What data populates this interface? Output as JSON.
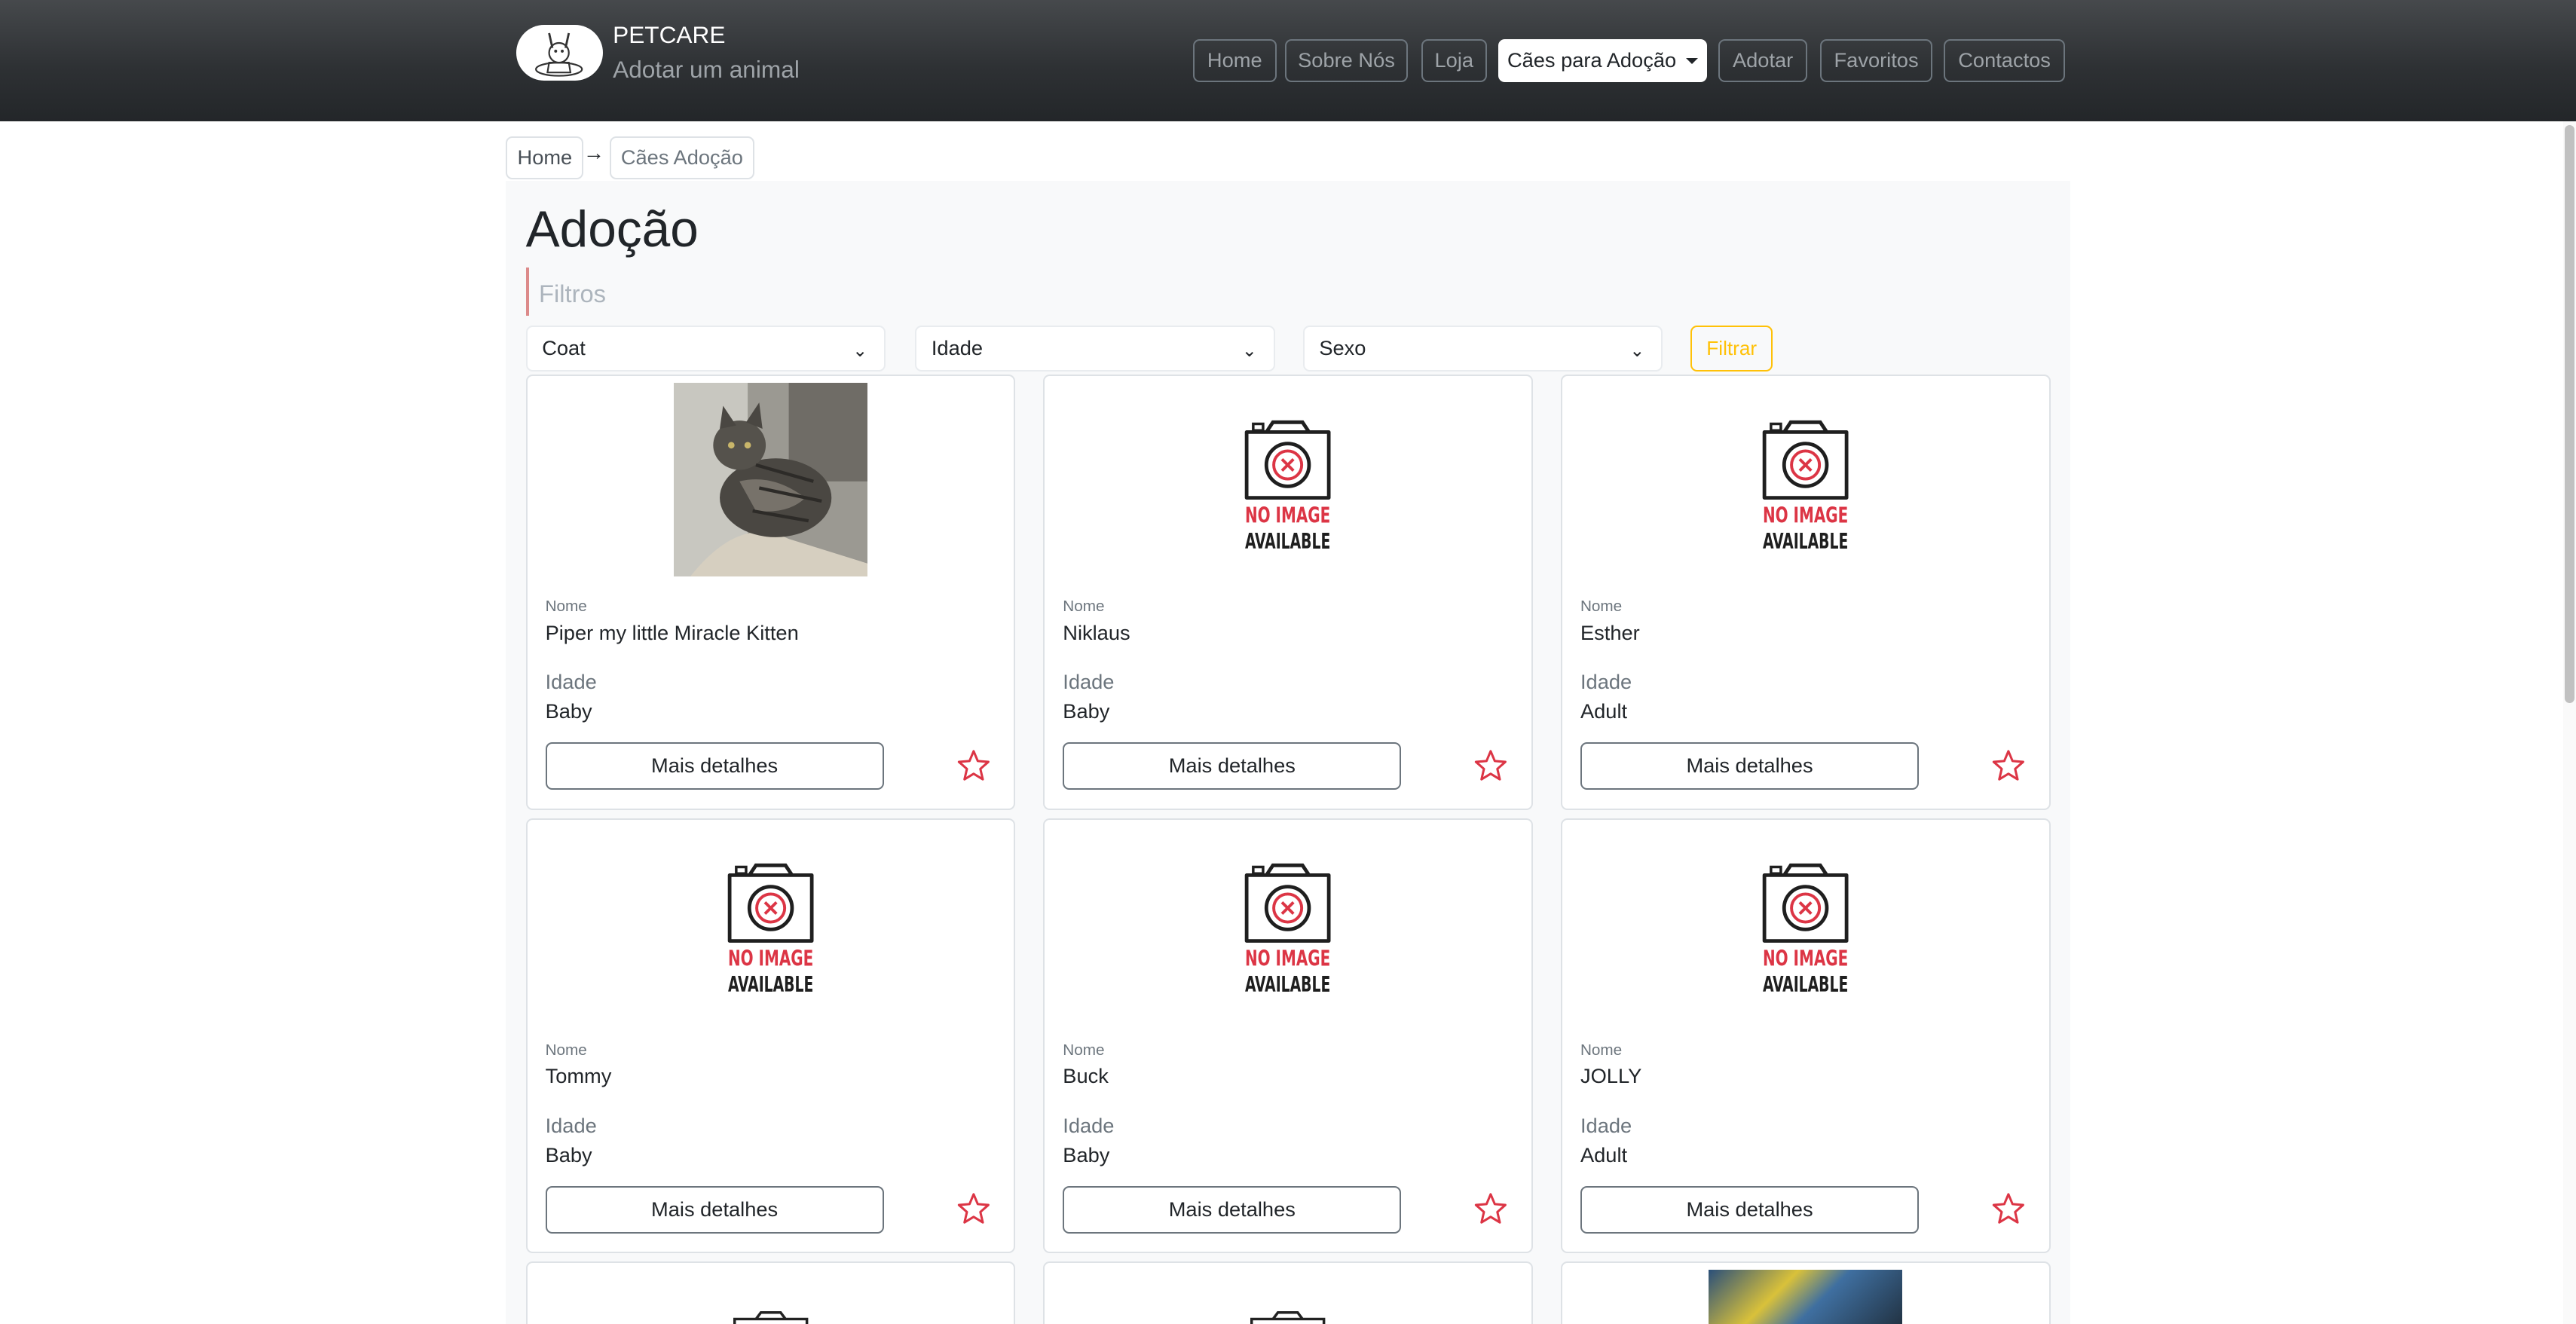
{
  "brand": {
    "title": "PETCARE",
    "subtitle": "Adotar um animal"
  },
  "nav": {
    "items": [
      "Home",
      "Sobre Nós",
      "Loja",
      "Cães para Adoção",
      "Adotar",
      "Favoritos",
      "Contactos"
    ],
    "active": "Cães para Adoção"
  },
  "breadcrumb": {
    "home": "Home",
    "current": "Cães Adoção"
  },
  "page": {
    "title": "Adoção",
    "filters_label": "Filtros"
  },
  "filters": {
    "coat": "Coat",
    "idade": "Idade",
    "sexo": "Sexo",
    "button": "Filtrar"
  },
  "card_labels": {
    "nome": "Nome",
    "idade": "Idade",
    "details": "Mais detalhes"
  },
  "no_image": {
    "line1": "NO IMAGE",
    "line2": "AVAILABLE"
  },
  "pets": [
    {
      "name": "Piper my little Miracle Kitten",
      "age": "Baby",
      "has_photo": true
    },
    {
      "name": "Niklaus",
      "age": "Baby",
      "has_photo": false
    },
    {
      "name": "Esther",
      "age": "Adult",
      "has_photo": false
    },
    {
      "name": "Tommy",
      "age": "Baby",
      "has_photo": false
    },
    {
      "name": "Buck",
      "age": "Baby",
      "has_photo": false
    },
    {
      "name": "JOLLY",
      "age": "Adult",
      "has_photo": false
    }
  ],
  "colors": {
    "accent": "#dc3545",
    "warning": "#ffc107",
    "navbar": "#2e3134"
  }
}
